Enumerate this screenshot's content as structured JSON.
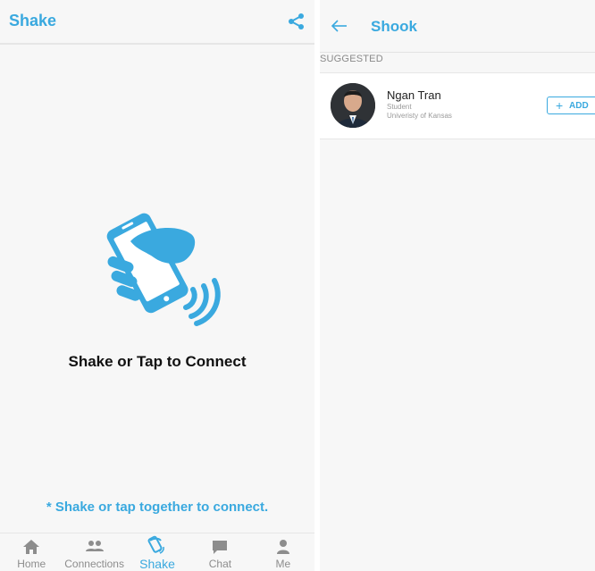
{
  "left": {
    "title": "Shake",
    "cta": "Shake or Tap to Connect",
    "hint": "* Shake or tap together to connect.",
    "tabs": [
      {
        "label": "Home",
        "icon": "home-icon"
      },
      {
        "label": "Connections",
        "icon": "people-icon"
      },
      {
        "label": "Shake",
        "icon": "shake-icon",
        "active": true
      },
      {
        "label": "Chat",
        "icon": "chat-icon"
      },
      {
        "label": "Me",
        "icon": "person-icon"
      }
    ]
  },
  "right": {
    "title": "Shook",
    "section": "SUGGESTED",
    "suggestion": {
      "name": "Ngan Tran",
      "role": "Student",
      "school": "Univeristy of Kansas",
      "add_label": "ADD"
    }
  },
  "colors": {
    "accent": "#3aa9df",
    "background": "#f7f7f7",
    "divider": "#e6e6e6",
    "muted": "#8d8d8d"
  }
}
